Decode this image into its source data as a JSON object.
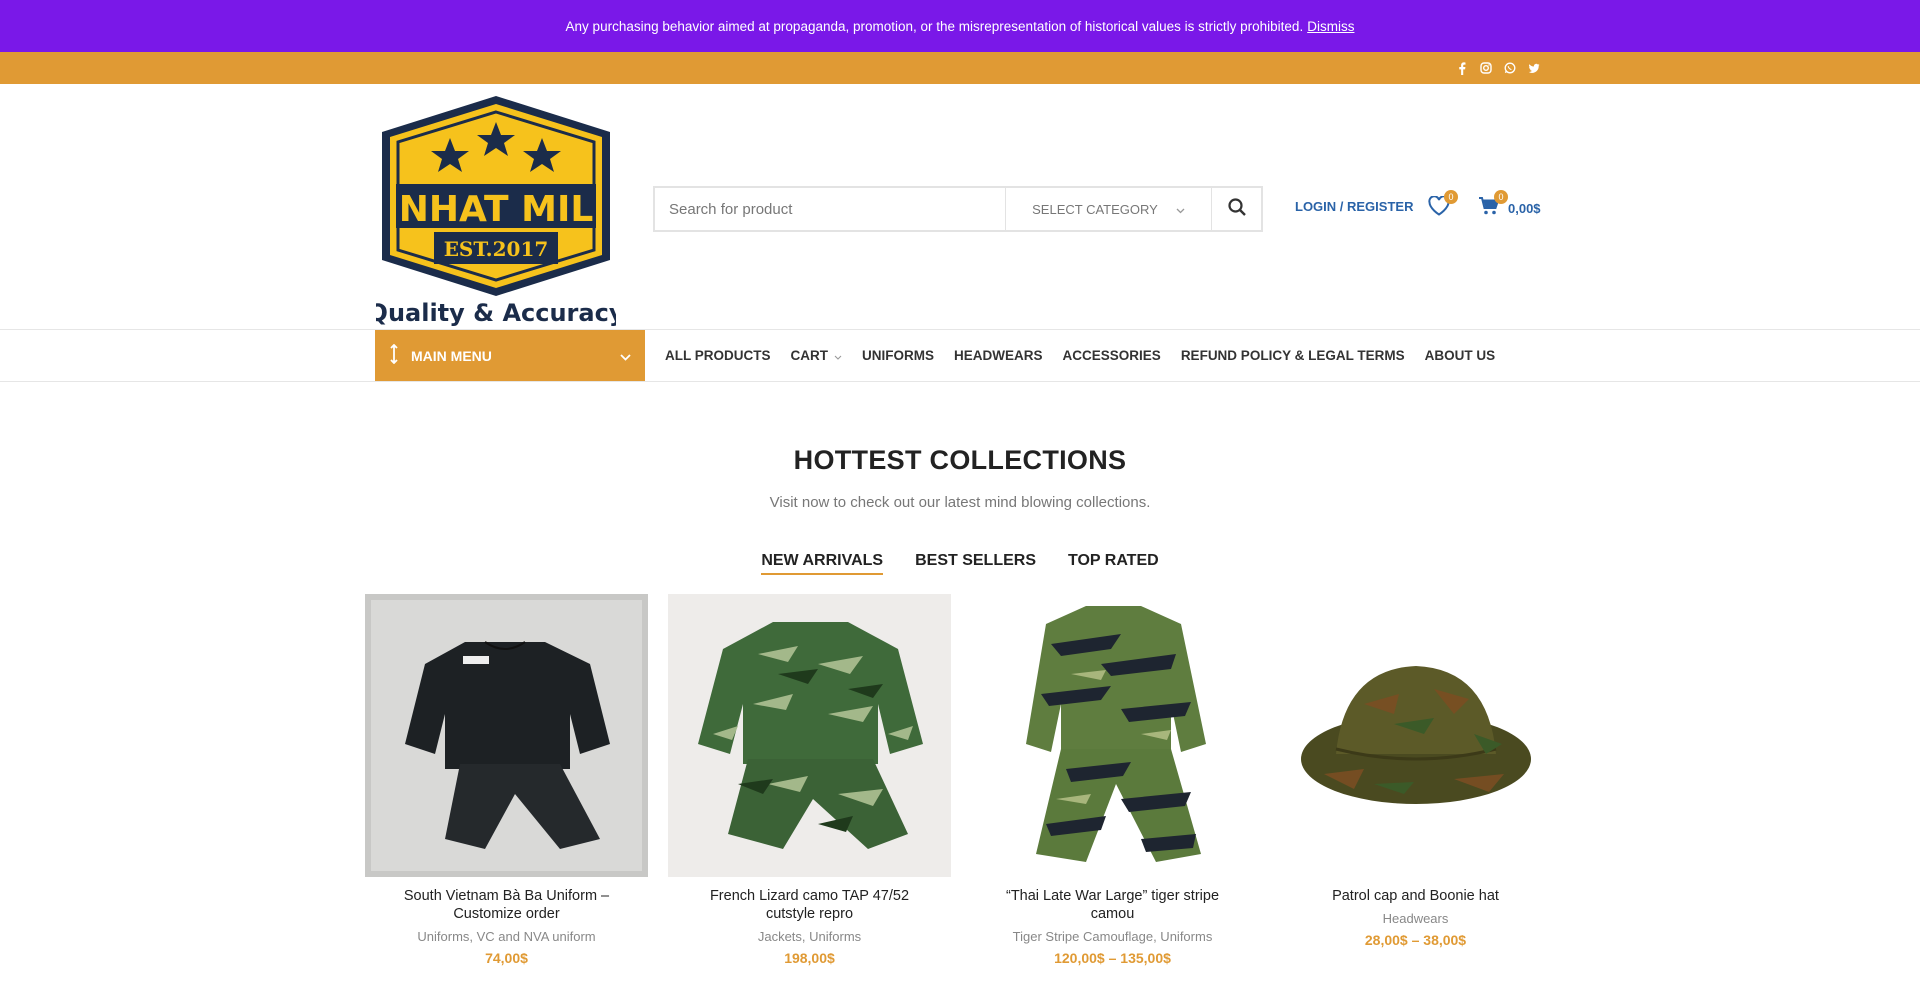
{
  "notice": {
    "text": "Any purchasing behavior aimed at propaganda, promotion, or the misrepresentation of historical values is strictly prohibited.",
    "dismiss": "Dismiss"
  },
  "social_icons": [
    "facebook-icon",
    "instagram-icon",
    "whatsapp-icon",
    "twitter-icon"
  ],
  "logo": {
    "brand": "NHAT MIL",
    "est": "EST.2017",
    "tagline": "Quality & Accuracy"
  },
  "search": {
    "placeholder": "Search for product",
    "category": "SELECT CATEGORY"
  },
  "header": {
    "login": "LOGIN / REGISTER",
    "wishlist_count": "0",
    "cart_count": "0",
    "cart_total": "0,00$"
  },
  "nav": {
    "main_menu": "MAIN MENU",
    "links": [
      "ALL PRODUCTS",
      "CART",
      "UNIFORMS",
      "HEADWEARS",
      "ACCESSORIES",
      "REFUND POLICY & LEGAL TERMS",
      "ABOUT US"
    ]
  },
  "section": {
    "title": "HOTTEST COLLECTIONS",
    "subtitle": "Visit now to check out our latest mind blowing collections.",
    "tabs": [
      "NEW ARRIVALS",
      "BEST SELLERS",
      "TOP RATED"
    ]
  },
  "products": [
    {
      "name": "South Vietnam Bà Ba Uniform – Customize order",
      "categories": "Uniforms, VC and NVA uniform",
      "price": "74,00$"
    },
    {
      "name": "French Lizard camo TAP 47/52 cutstyle repro",
      "categories": "Jackets, Uniforms",
      "price": "198,00$"
    },
    {
      "name": "“Thai Late War Large” tiger stripe camou",
      "categories": "Tiger Stripe Camouflage, Uniforms",
      "price": "120,00$ – 135,00$"
    },
    {
      "name": "Patrol cap and Boonie hat",
      "categories": "Headwears",
      "price": "28,00$ – 38,00$"
    }
  ],
  "colors": {
    "notice_bg": "#7a18e8",
    "accent": "#e09a34",
    "link": "#2a63a8"
  }
}
